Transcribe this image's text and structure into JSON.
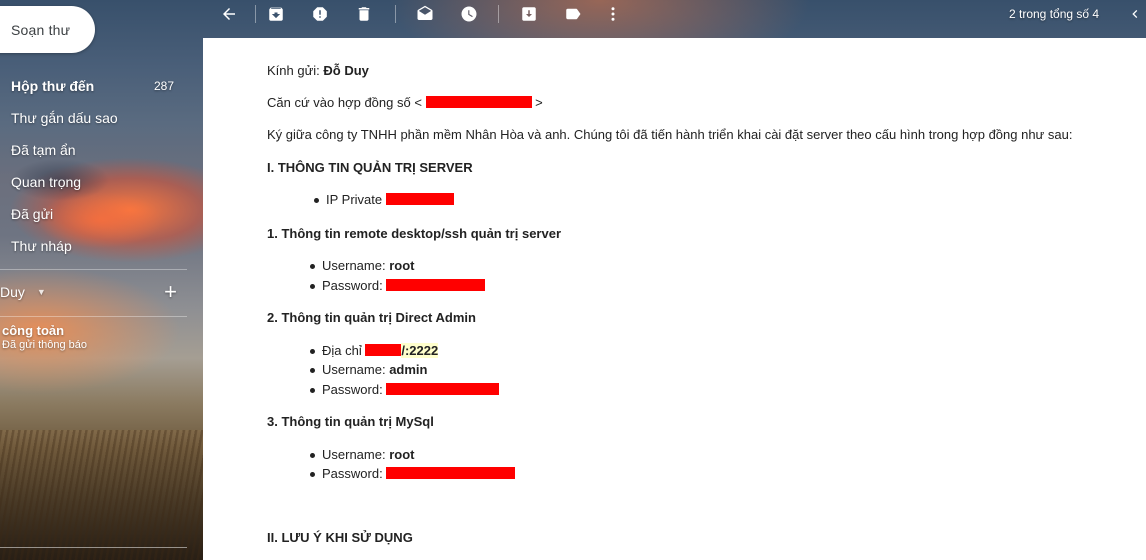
{
  "compose_label": "Soạn thư",
  "sidebar": {
    "items": [
      {
        "label": "Hộp thư đến",
        "count": "287"
      },
      {
        "label": "Thư gắn dấu sao"
      },
      {
        "label": "Đã tạm ẩn"
      },
      {
        "label": "Quan trọng"
      },
      {
        "label": "Đã gửi"
      },
      {
        "label": "Thư nháp"
      }
    ],
    "account_name": "Duy",
    "chat_contact": {
      "name": "công toản",
      "status": "Đã gửi thông báo"
    }
  },
  "toolbar": {
    "icons": [
      "back-arrow-icon",
      "archive-icon",
      "report-spam-icon",
      "delete-icon",
      "mark-unread-icon",
      "snooze-icon",
      "move-to-icon",
      "label-icon",
      "more-vert-icon"
    ],
    "page_count": "2 trong tổng số 4"
  },
  "message": {
    "greeting_prefix": "Kính gửi: ",
    "greeting_name": "Đỗ Duy",
    "contract_prefix": "Căn cứ vào hợp đồng số < ",
    "contract_suffix": " >",
    "intro": "Ký giữa công ty TNHH phần mềm Nhân Hòa và anh. Chúng tôi đã tiến hành triển khai cài đặt server theo cấu hình trong hợp đồng như sau:",
    "section1": "I. THÔNG TIN QUẢN TRỊ SERVER",
    "ip_label": "IP Private ",
    "sub1": "1. Thông tin remote desktop/ssh quản trị server",
    "sub1_username_label": "Username: ",
    "sub1_username": "root",
    "sub1_password_label": "Password: ",
    "sub2": "2. Thông tin quản trị Direct Admin",
    "sub2_address_label": "Địa chỉ ",
    "sub2_port": "/:2222",
    "sub2_username_label": "Username: ",
    "sub2_username": "admin",
    "sub2_password_label": "Password: ",
    "sub3": "3. Thông tin quản trị MySql",
    "sub3_username_label": "Username: ",
    "sub3_username": "root",
    "sub3_password_label": "Password: ",
    "section2": "II. LƯU Ý KHI SỬ DỤNG"
  },
  "colors": {
    "redaction": "#ff0000",
    "highlight": "#ffffcc",
    "text": "#222222"
  }
}
